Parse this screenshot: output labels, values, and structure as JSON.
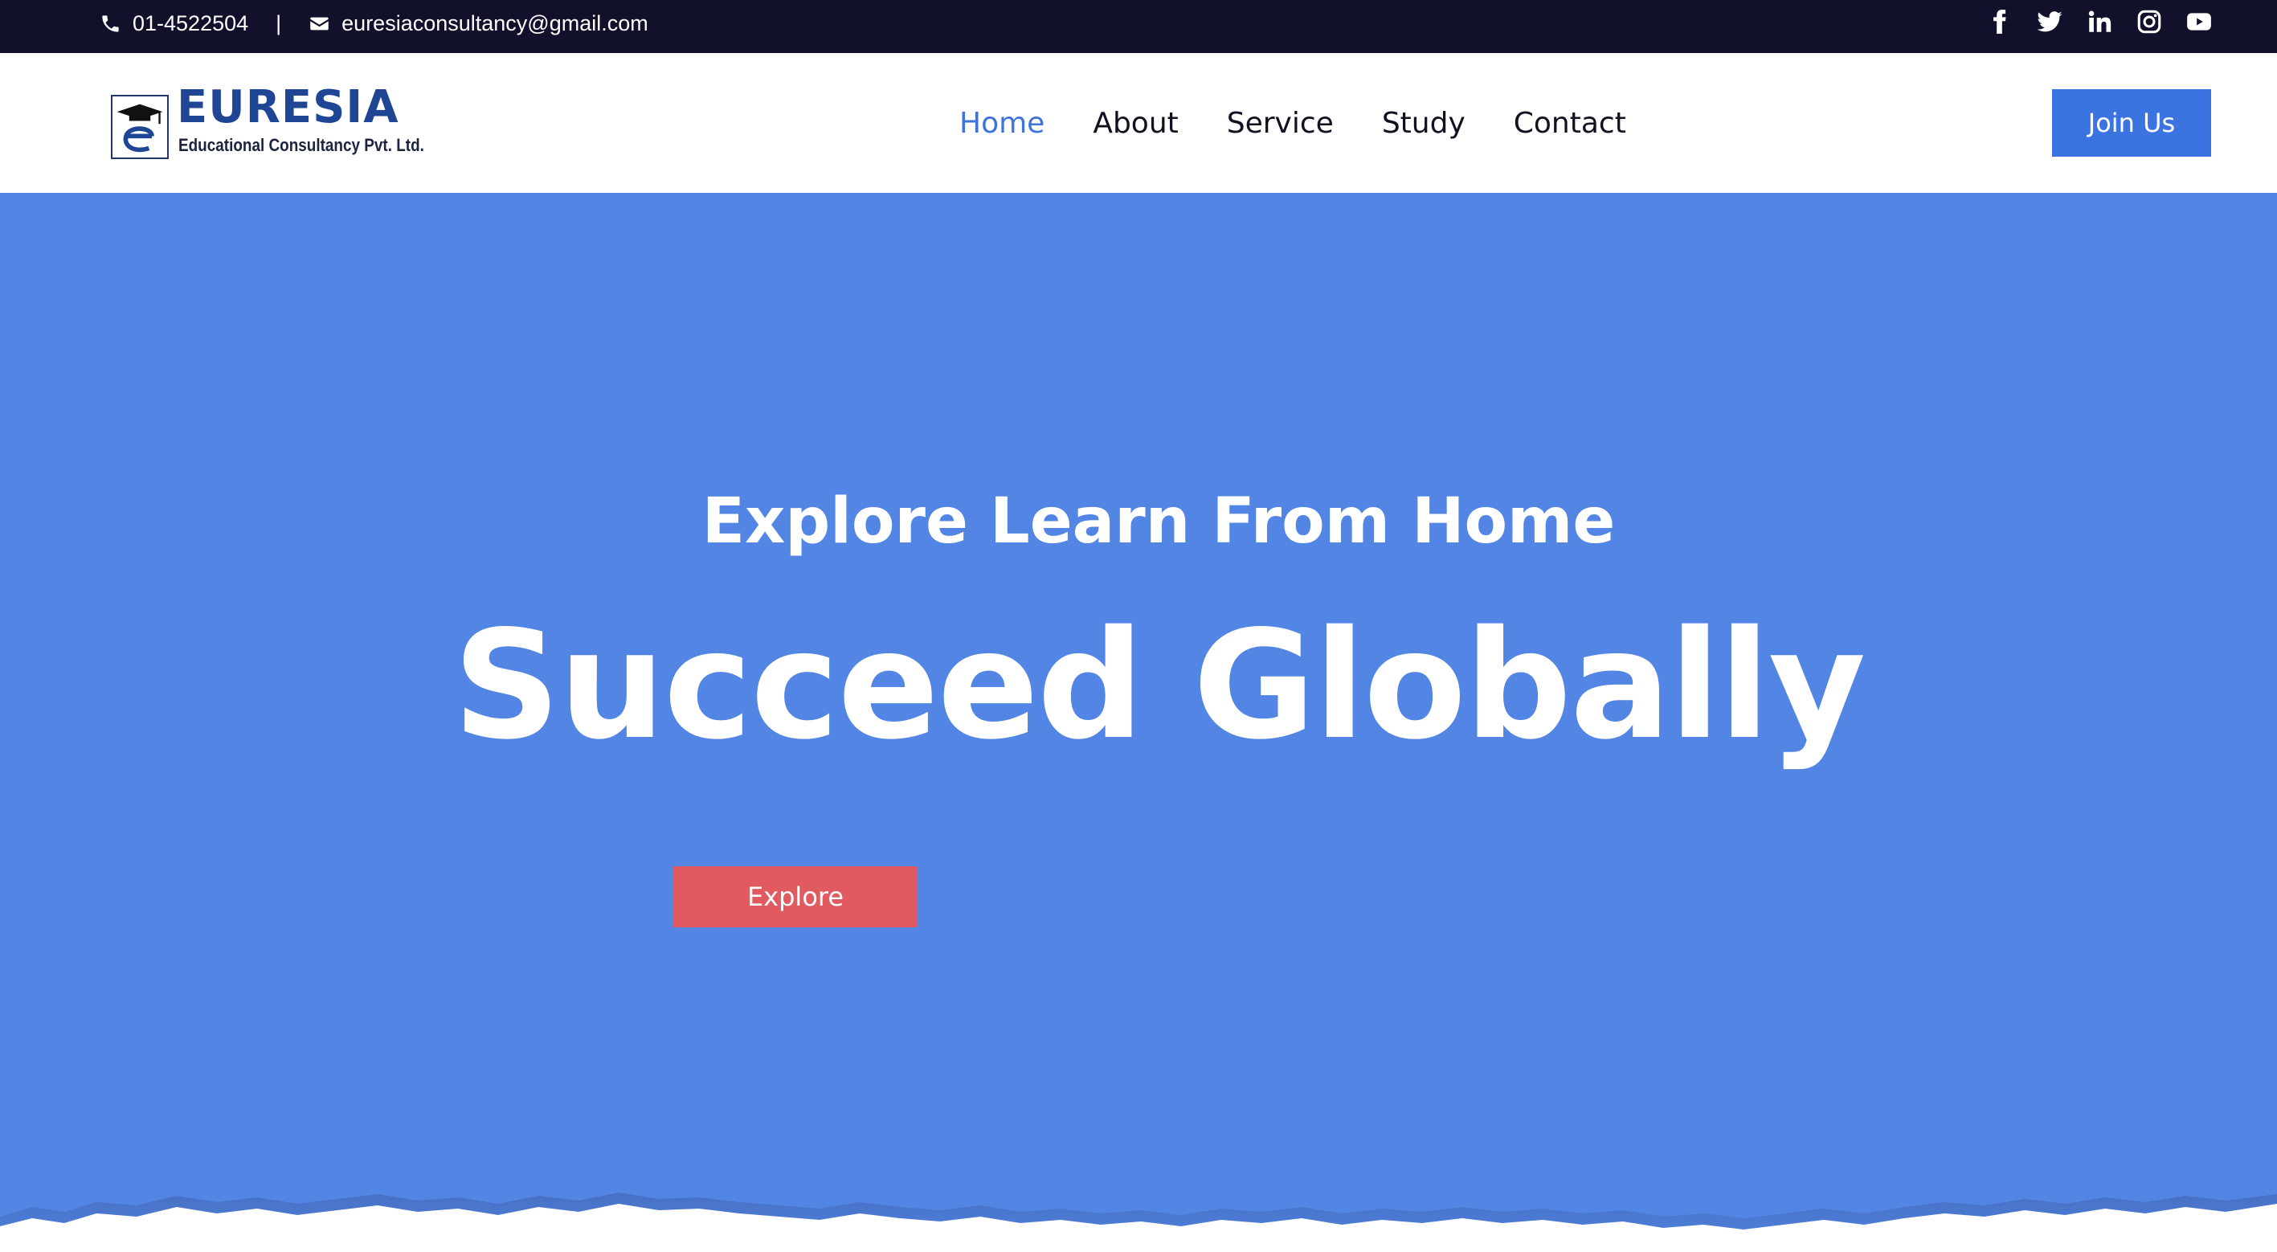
{
  "topbar": {
    "phone": "01-4522504",
    "separator": "|",
    "email": "euresiaconsultancy@gmail.com",
    "social_icons": [
      "facebook-icon",
      "twitter-icon",
      "linkedin-icon",
      "instagram-icon",
      "youtube-icon"
    ]
  },
  "header": {
    "logo": {
      "brand": "EURESIA",
      "tagline": "Educational Consultancy Pvt. Ltd."
    },
    "nav": [
      {
        "label": "Home",
        "active": true
      },
      {
        "label": "About",
        "active": false
      },
      {
        "label": "Service",
        "active": false
      },
      {
        "label": "Study",
        "active": false
      },
      {
        "label": "Contact",
        "active": false
      }
    ],
    "join_label": "Join Us"
  },
  "hero": {
    "kicker": "Explore Learn From Home",
    "headline": "Succeed Globally",
    "explore_label": "Explore"
  },
  "colors": {
    "topbar_bg": "#12112b",
    "hero_bg": "#5285e4",
    "accent_blue": "#3b74e0",
    "explore_red": "#e05a5f",
    "brand_blue": "#1f4595"
  }
}
